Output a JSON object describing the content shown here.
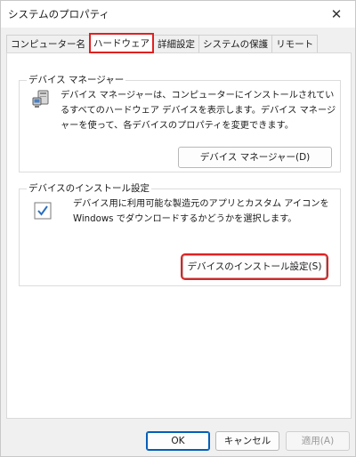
{
  "window": {
    "title": "システムのプロパティ",
    "close_glyph": "✕"
  },
  "tabs": [
    {
      "label": "コンピューター名"
    },
    {
      "label": "ハードウェア"
    },
    {
      "label": "詳細設定"
    },
    {
      "label": "システムの保護"
    },
    {
      "label": "リモート"
    }
  ],
  "device_manager": {
    "group_label": "デバイス マネージャー",
    "description": "デバイス マネージャーは、コンピューターにインストールされているすべてのハードウェア デバイスを表示します。デバイス マネージャーを使って、各デバイスのプロパティを変更できます。",
    "button_label": "デバイス マネージャー(D)",
    "icon": "device-manager-icon"
  },
  "device_install": {
    "group_label": "デバイスのインストール設定",
    "description": "デバイス用に利用可能な製造元のアプリとカスタム アイコンを Windows でダウンロードするかどうかを選択します。",
    "button_label": "デバイスのインストール設定(S)",
    "icon": "checkbox-settings-icon"
  },
  "footer": {
    "ok_label": "OK",
    "cancel_label": "キャンセル",
    "apply_label": "適用(A)"
  },
  "colors": {
    "highlight": "#e02020",
    "accent": "#005fb8"
  }
}
